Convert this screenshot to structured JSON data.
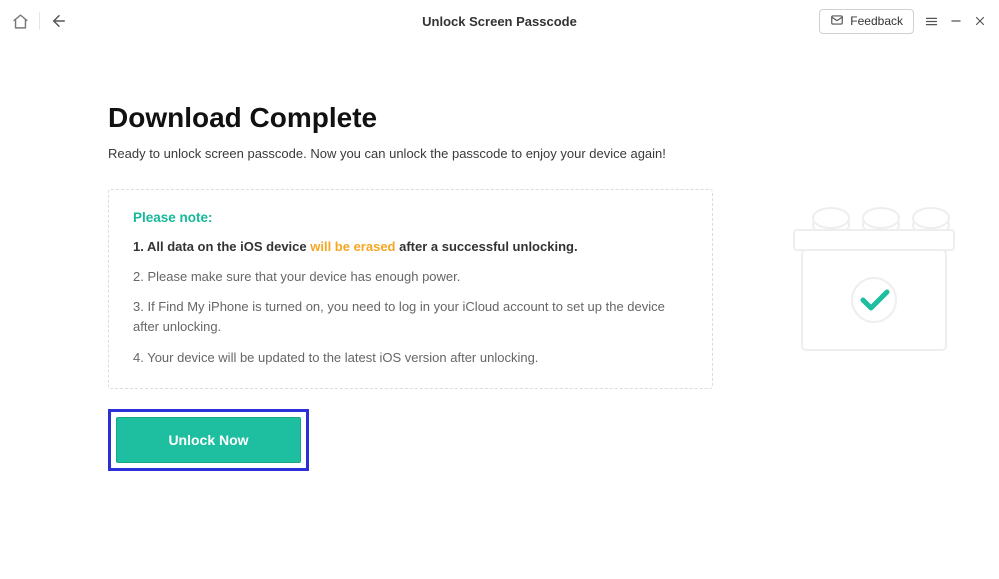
{
  "titlebar": {
    "title": "Unlock Screen Passcode",
    "feedback_label": "Feedback"
  },
  "heading": "Download Complete",
  "subtitle": "Ready to unlock screen passcode. Now you can unlock the passcode to enjoy your device again!",
  "note": {
    "title": "Please note:",
    "line1_pre": "1. All data on the iOS device ",
    "line1_accent": "will be erased",
    "line1_post": " after a successful unlocking.",
    "line2": "2. Please make sure that your device has enough power.",
    "line3": "3. If Find My iPhone is turned on, you need to log in your iCloud account to set up the device after unlocking.",
    "line4": "4. Your device will be updated to the latest iOS version after unlocking."
  },
  "actions": {
    "unlock_label": "Unlock Now"
  }
}
